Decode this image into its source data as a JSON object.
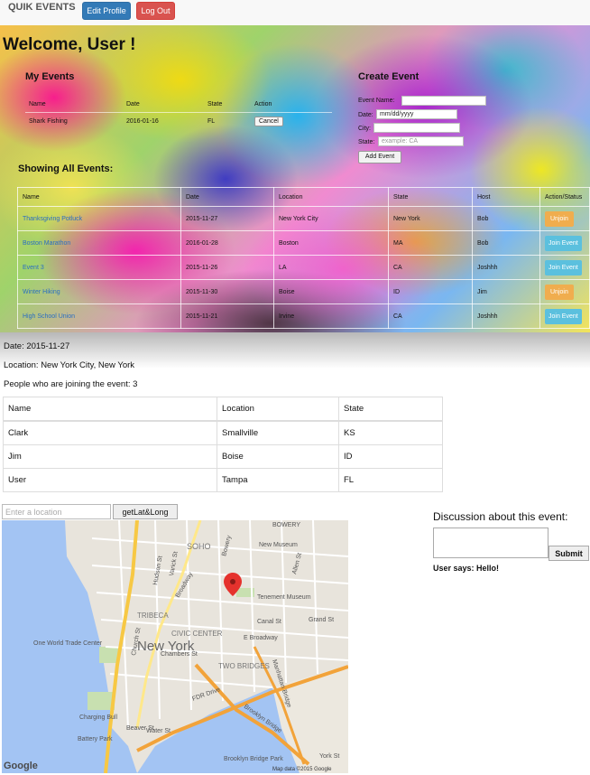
{
  "nav": {
    "brand": "QUIK EVENTS",
    "edit_profile": "Edit Profile",
    "logout": "Log Out"
  },
  "welcome": "Welcome, User !",
  "my_events": {
    "title": "My Events",
    "headers": [
      "Name",
      "Date",
      "State",
      "Action"
    ],
    "rows": [
      {
        "name": "Shark Fishing",
        "date": "2016-01-16",
        "state": "FL",
        "action": "Cancel"
      }
    ]
  },
  "create_event": {
    "title": "Create Event",
    "name_label": "Event Name:",
    "date_label": "Date:",
    "date_placeholder": "mm/dd/yyyy",
    "city_label": "City:",
    "state_label": "State:",
    "state_placeholder": "example: CA",
    "submit": "Add Event"
  },
  "all_events": {
    "title": "Showing All Events:",
    "headers": [
      "Name",
      "Date",
      "Location",
      "State",
      "Host",
      "Action/Status"
    ],
    "rows": [
      {
        "name": "Thanksgiving Potluck",
        "date": "2015-11-27",
        "location": "New York City",
        "state": "New York",
        "host": "Bob",
        "action": "Unjoin"
      },
      {
        "name": "Boston Marathon",
        "date": "2016-01-28",
        "location": "Boston",
        "state": "MA",
        "host": "Bob",
        "action": "Join Event"
      },
      {
        "name": "Event 3",
        "date": "2015-11-26",
        "location": "LA",
        "state": "CA",
        "host": "Joshhh",
        "action": "Join Event"
      },
      {
        "name": "Winter Hiking",
        "date": "2015-11-30",
        "location": "Boise",
        "state": "ID",
        "host": "Jim",
        "action": "Unjoin"
      },
      {
        "name": "High School Union",
        "date": "2015-11-21",
        "location": "Irvine",
        "state": "CA",
        "host": "Joshhh",
        "action": "Join Event"
      }
    ]
  },
  "detail": {
    "date": "Date: 2015-11-27",
    "location": "Location: New York City, New York",
    "joining": "People who are joining the event: 3",
    "headers": [
      "Name",
      "Location",
      "State"
    ],
    "rows": [
      {
        "name": "Clark",
        "location": "Smallville",
        "state": "KS"
      },
      {
        "name": "Jim",
        "location": "Boise",
        "state": "ID"
      },
      {
        "name": "User",
        "location": "Tampa",
        "state": "FL"
      }
    ]
  },
  "location_search": {
    "placeholder": "Enter a location",
    "button": "getLat&Long"
  },
  "map": {
    "city_label": "New York",
    "labels": [
      "BOWERY",
      "New Museum",
      "SOHO",
      "TRIBECA",
      "CIVIC CENTER",
      "One World Trade Center",
      "TWO BRIDGES",
      "Tenement Museum",
      "Canal St",
      "Grand St",
      "E Broadway",
      "Charging Bull",
      "Beaver St",
      "Water St",
      "Battery Park",
      "FDR Drive",
      "Brooklyn Bridge",
      "Manhattan Bridge",
      "York St",
      "Brooklyn Bridge Park",
      "Broadway",
      "Hudson St",
      "Varick St",
      "Bowery",
      "Allen St",
      "Church St",
      "Chambers St"
    ],
    "google": "Google",
    "attribution": "Map data ©2015 Google"
  },
  "discussion": {
    "title": "Discussion about this event:",
    "submit": "Submit",
    "comment": "User says: Hello!"
  }
}
